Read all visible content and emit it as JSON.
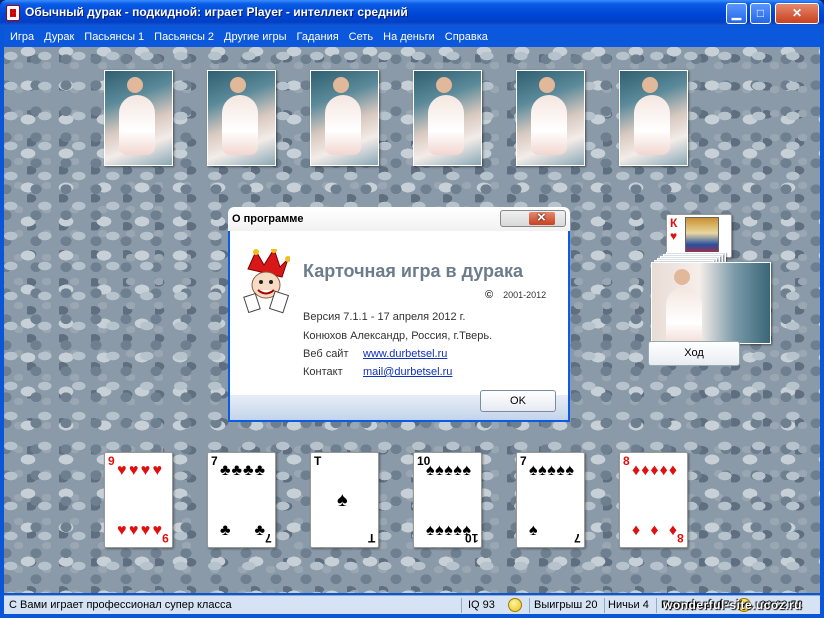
{
  "window": {
    "title": "Обычный дурак - подкидной: играет Player - интеллект средний",
    "min": "▁",
    "max": "□",
    "close": "✕"
  },
  "menu": [
    "Игра",
    "Дурак",
    "Пасьянсы 1",
    "Пасьянсы 2",
    "Другие игры",
    "Гадания",
    "Сеть",
    "На деньги",
    "Справка"
  ],
  "opponent_cards": 6,
  "trump": {
    "rank": "К",
    "suit": "♥",
    "color": "red"
  },
  "player_cards": [
    {
      "rank": "9",
      "suit": "♥",
      "color": "red"
    },
    {
      "rank": "7",
      "suit": "♣",
      "color": "black"
    },
    {
      "rank": "Т",
      "suit": "♠",
      "color": "black"
    },
    {
      "rank": "10",
      "suit": "♠",
      "color": "black"
    },
    {
      "rank": "7",
      "suit": "♠",
      "color": "black"
    },
    {
      "rank": "8",
      "suit": "♦",
      "color": "red"
    }
  ],
  "move_button": "Ход",
  "about": {
    "title": "О программе",
    "product": "Карточная игра в дурака",
    "copyright_symbol": "©",
    "copyright_years": "2001-2012",
    "version": "Версия 7.1.1 - 17 апреля 2012 г.",
    "author": "Конюхов Александр, Россия, г.Тверь.",
    "website_label": "Веб сайт",
    "website": "www.durbetsel.ru",
    "contact_label": "Контакт",
    "contact": "mail@durbetsel.ru",
    "ok": "OK"
  },
  "status": {
    "message": "С Вами играет профессионал супер класса",
    "iq": "IQ 93",
    "wins": "Выигрыш 20",
    "draws": "Ничьи 4",
    "losses": "Проигрыш 17",
    "timer": "00:02:52"
  },
  "watermark": "wonderful-site.ucoz.ru"
}
